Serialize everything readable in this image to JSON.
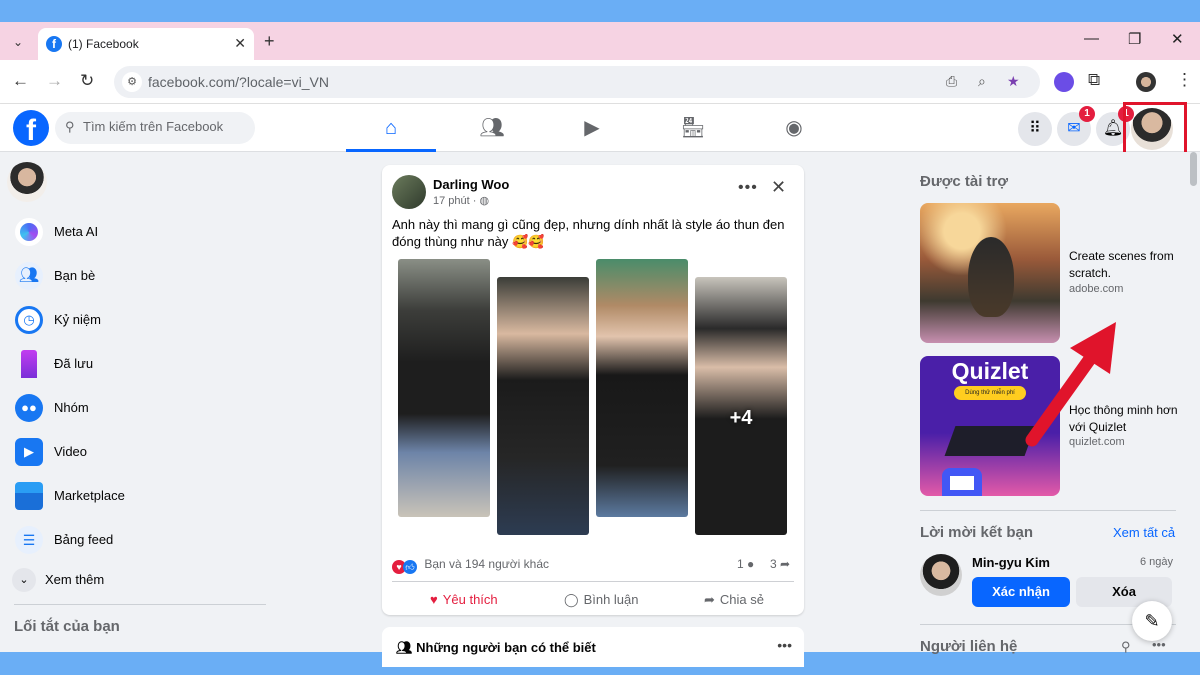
{
  "browser": {
    "tab_title": "(1) Facebook",
    "url": "facebook.com/?locale=vi_VN",
    "tab_close": "✕",
    "new_tab": "+",
    "minimize": "—",
    "restore": "❐",
    "close": "✕"
  },
  "fb_header": {
    "logo": "f",
    "search_placeholder": "Tìm kiếm trên Facebook",
    "messenger_badge": "1",
    "notifications_badge": "1",
    "nav_icons": [
      "home-icon",
      "friends-icon",
      "video-icon",
      "marketplace-icon",
      "groups-icon"
    ]
  },
  "left_nav": {
    "items": [
      {
        "label": "Meta AI",
        "icon": "meta-ai-icon",
        "color": "#5a6cf5"
      },
      {
        "label": "Bạn bè",
        "icon": "friends-icon",
        "color": "#1877f2"
      },
      {
        "label": "Kỷ niệm",
        "icon": "memories-icon",
        "color": "#1877f2"
      },
      {
        "label": "Đã lưu",
        "icon": "saved-icon",
        "color": "#a033e0"
      },
      {
        "label": "Nhóm",
        "icon": "groups-icon",
        "color": "#1877f2"
      },
      {
        "label": "Video",
        "icon": "video-icon",
        "color": "#1877f2"
      },
      {
        "label": "Marketplace",
        "icon": "marketplace-icon",
        "color": "#1877f2"
      },
      {
        "label": "Bảng feed",
        "icon": "feeds-icon",
        "color": "#1877f2"
      }
    ],
    "see_more": "Xem thêm",
    "shortcuts_title": "Lối tắt của bạn"
  },
  "post": {
    "author": "Darling Woo",
    "time": "17 phút · ",
    "text": "Anh này thì mang gì cũng đẹp, nhưng dính nhất là style áo thun đen đóng thùng như này 🥰🥰",
    "more_photos": "+4",
    "reactions_text": "Bạn và 194 người khác",
    "comments_count": "1",
    "shares_count": "3",
    "like_label": "Yêu thích",
    "comment_label": "Bình luận",
    "share_label": "Chia sẻ"
  },
  "people_you_may_know": {
    "title": "Những người bạn có thể biết"
  },
  "right_col": {
    "sponsored_title": "Được tài trợ",
    "ads": [
      {
        "text": "Create scenes from scratch.",
        "domain": "adobe.com"
      },
      {
        "text": "Học thông minh hơn với Quizlet",
        "domain": "quizlet.com",
        "brand": "Quizlet",
        "promo": "Dùng thử miễn phí"
      }
    ],
    "friend_requests_title": "Lời mời kết bạn",
    "see_all": "Xem tất cả",
    "request": {
      "name": "Min-gyu Kim",
      "time": "6 ngày",
      "confirm": "Xác nhận",
      "delete": "Xóa"
    },
    "contacts_title": "Người liên hệ"
  },
  "colors": {
    "fb_blue": "#0866ff",
    "highlight_red": "#e0142b",
    "love_red": "#e41e3f"
  }
}
